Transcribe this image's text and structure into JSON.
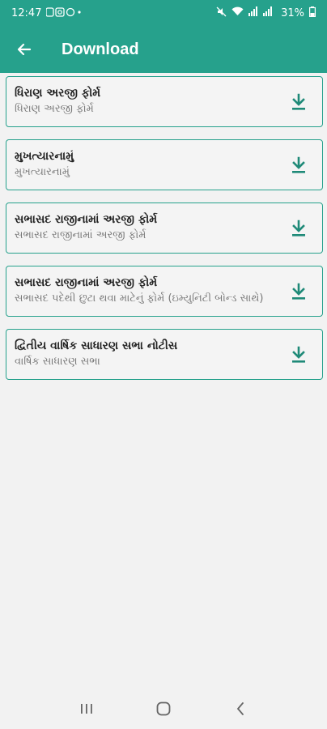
{
  "status_bar": {
    "time": "12:47",
    "battery": "31%",
    "colors": {
      "bg": "#26a18c"
    }
  },
  "app_bar": {
    "title": "Download",
    "back_icon": "arrow-left-icon"
  },
  "items": [
    {
      "title": "ધિરાણ અરજી ફોર્મ",
      "subtitle": "ધિરાણ અરજી ફોર્મ"
    },
    {
      "title": "મુખત્યારનામું",
      "subtitle": "મુખત્યારનામું"
    },
    {
      "title": "સભાસદ રાજીનામાં અરજી ફોર્મ",
      "subtitle": "સભાસદ રાજીનામાં અરજી ફોર્મ"
    },
    {
      "title": "સભાસદ રાજીનામાં અરજી ફોર્મ",
      "subtitle": "સભાસદ પદેથી છુટા થવા માટેનું ફોર્મ (ઇમ્યુનિટી બોન્ડ સાથે)"
    },
    {
      "title": "દ્વિતીય વાર્ષિક સાધારણ સભા નોટીસ",
      "subtitle": "વાર્ષિક સાધારણ સભા"
    }
  ],
  "download_icon": "download-icon",
  "accent_color": "#26a18c"
}
